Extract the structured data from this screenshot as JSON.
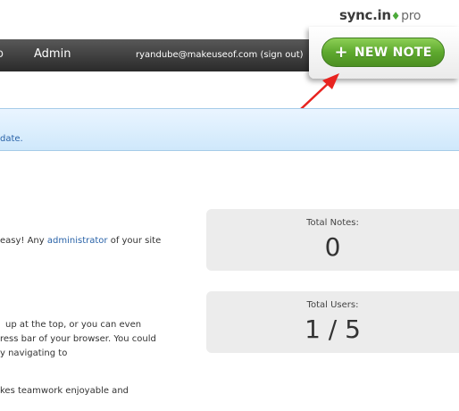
{
  "brand": {
    "name": "sync.in",
    "logo_mark": "♦",
    "tier": "pro"
  },
  "nav": {
    "partial_item": "o",
    "admin": "Admin",
    "user_email": "ryandube@makeuseof.com",
    "sign_out": "(sign out)"
  },
  "new_note": {
    "icon": "+",
    "label": "NEW NOTE"
  },
  "notice": {
    "text": "date."
  },
  "content": {
    "line1_prefix": "easy! Any ",
    "line1_link": "administrator",
    "line1_suffix": " of your site",
    "line2": "up at the top, or you can even",
    "line3": "ress bar of your browser. You could",
    "line4": "y navigating to",
    "line5": "kes teamwork enjoyable and"
  },
  "stats": {
    "notes_label": "Total Notes:",
    "notes_value": "0",
    "users_label": "Total Users:",
    "users_value": "1 / 5"
  },
  "colors": {
    "accent_green": "#5ea92e",
    "link_blue": "#2a63a8",
    "annotation_arrow": "#e8231f"
  }
}
